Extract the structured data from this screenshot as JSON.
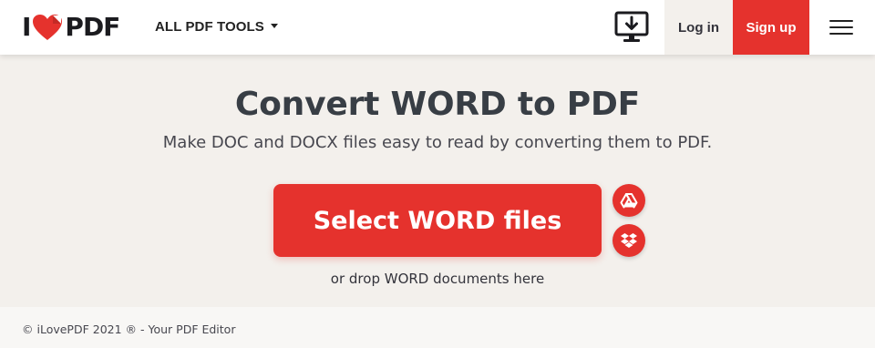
{
  "header": {
    "logo": {
      "prefix": "I",
      "suffix": "PDF",
      "icon": "heart-icon"
    },
    "tools_menu_label": "ALL PDF TOOLS",
    "desktop_icon": "desktop-download-icon",
    "login_label": "Log in",
    "signup_label": "Sign up",
    "menu_icon": "hamburger-menu-icon"
  },
  "main": {
    "title": "Convert WORD to PDF",
    "subtitle": "Make DOC and DOCX files easy to read by converting them to PDF.",
    "select_button_label": "Select WORD files",
    "cloud_sources": [
      {
        "name": "Google Drive",
        "icon": "google-drive-icon"
      },
      {
        "name": "Dropbox",
        "icon": "dropbox-icon"
      }
    ],
    "drop_text": "or drop WORD documents here"
  },
  "footer": {
    "copyright": "© iLovePDF 2021 ® - Your PDF Editor"
  },
  "colors": {
    "brand_red": "#e5322d",
    "page_background": "#f3f0ec",
    "header_background": "#ffffff",
    "text_dark": "#33333b"
  }
}
